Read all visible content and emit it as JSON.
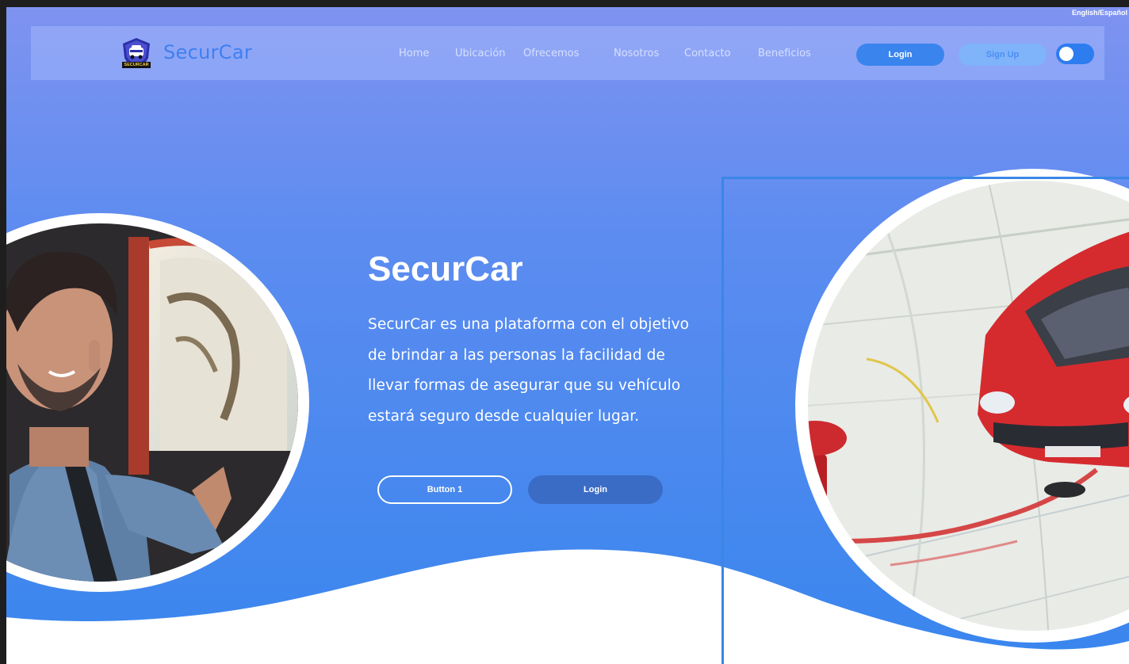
{
  "top_corner": {
    "lang_toggle": "English/Español"
  },
  "navbar": {
    "brand": "SecurCar",
    "logo_text": "SECURCAR",
    "links": [
      "Home",
      "Ubicación",
      "Ofrecemos",
      "Nosotros",
      "Contacto",
      "Beneficios"
    ],
    "login_label": "Login",
    "signup_label": "Sign Up"
  },
  "hero": {
    "title": "SecurCar",
    "description": "SecurCar es una plataforma con el objetivo de brindar a las personas la facilidad de llevar formas de asegurar que su vehículo estará seguro desde cualquier lugar.",
    "button1_label": "Button 1",
    "button2_label": "Login"
  },
  "colors": {
    "accent": "#3a84ee",
    "hero_top": "#7f95f0",
    "hero_bottom": "#3a86ee",
    "button_dark": "#3a6cc6"
  }
}
